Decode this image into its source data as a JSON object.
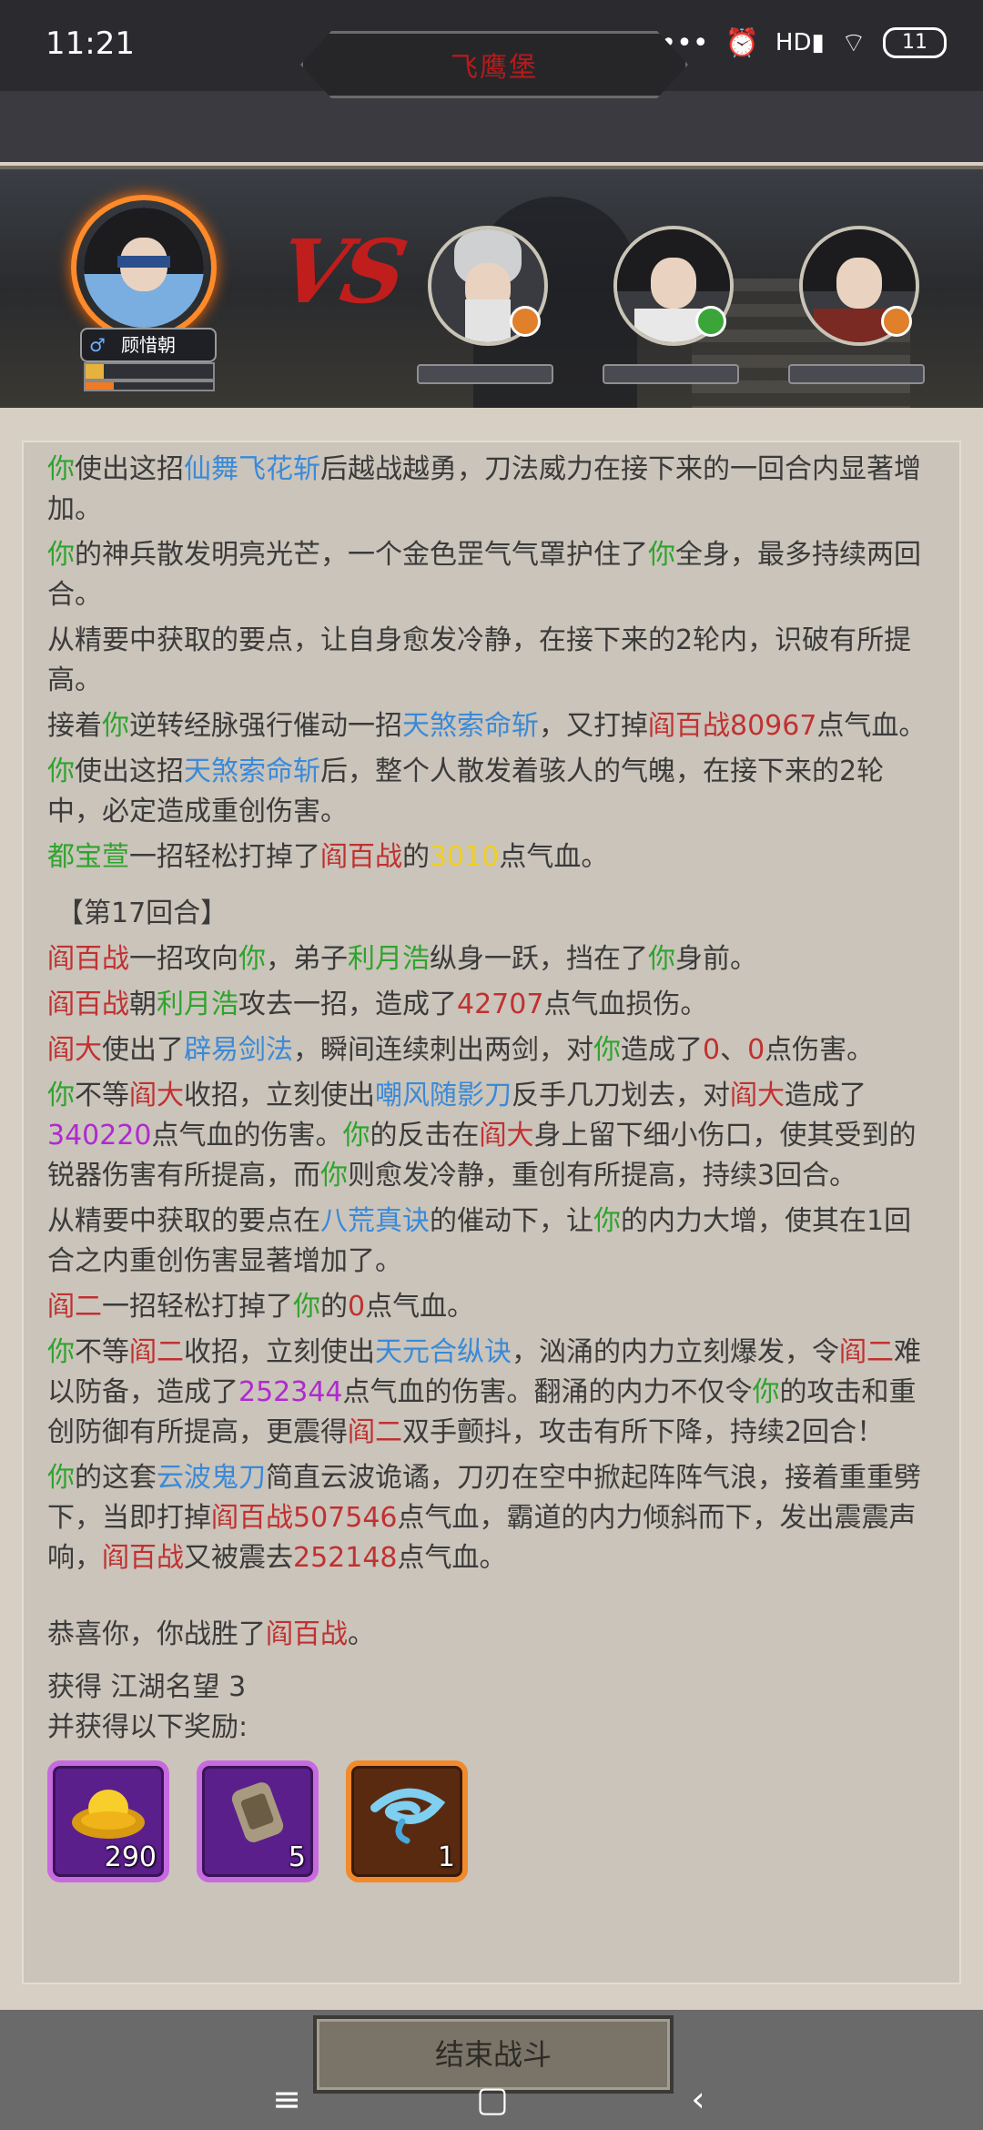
{
  "status_bar": {
    "time": "11:21",
    "icons": [
      "more-dots-icon",
      "alarm-icon",
      "hd-signal-icon",
      "wifi-icon"
    ],
    "battery": "11"
  },
  "header": {
    "title": "飞鹰堡"
  },
  "battle": {
    "player_name": "顾惜朝",
    "player_hp_fraction": 0.14,
    "player_energy_fraction": 0.22,
    "vs_label": "VS",
    "enemies": [
      {
        "portrait": "white-haired-elder",
        "badge_color": "#e0802a"
      },
      {
        "portrait": "white-robed-swordsman",
        "badge_color": "#3aa63a"
      },
      {
        "portrait": "red-robed-warrior",
        "badge_color": "#e0802a"
      }
    ]
  },
  "log": {
    "lines1": [
      [
        {
          "t": "你",
          "c": "g"
        },
        {
          "t": "使出这招"
        },
        {
          "t": "仙舞飞花斩",
          "c": "b"
        },
        {
          "t": "后越战越勇，刀法威力在接下来的一回合内显著增加。"
        }
      ],
      [
        {
          "t": "你",
          "c": "g"
        },
        {
          "t": "的神兵散发明亮光芒，一个金色罡气气罩护住了"
        },
        {
          "t": "你",
          "c": "g"
        },
        {
          "t": "全身，最多持续两回合。"
        }
      ],
      [
        {
          "t": "从精要中获取的要点，让自身愈发冷静，在接下来的2轮内，识破有所提高。"
        }
      ],
      [
        {
          "t": "接着"
        },
        {
          "t": "你",
          "c": "g"
        },
        {
          "t": "逆转经脉强行催动一招"
        },
        {
          "t": "天煞索命斩",
          "c": "b"
        },
        {
          "t": "，又打掉"
        },
        {
          "t": "阎百战",
          "c": "r"
        },
        {
          "t": "80967",
          "c": "r"
        },
        {
          "t": "点气血。"
        }
      ],
      [
        {
          "t": "你",
          "c": "g"
        },
        {
          "t": "使出这招"
        },
        {
          "t": "天煞索命斩",
          "c": "b"
        },
        {
          "t": "后，整个人散发着骇人的气魄，在接下来的2轮中，必定造成重创伤害。"
        }
      ],
      [
        {
          "t": "都宝萱",
          "c": "g"
        },
        {
          "t": "一招轻松打掉了"
        },
        {
          "t": "阎百战",
          "c": "r"
        },
        {
          "t": "的"
        },
        {
          "t": "3010",
          "c": "y"
        },
        {
          "t": "点气血。"
        }
      ]
    ],
    "round_header": "【第17回合】",
    "lines2": [
      [
        {
          "t": "阎百战",
          "c": "r"
        },
        {
          "t": "一招攻向"
        },
        {
          "t": "你",
          "c": "g"
        },
        {
          "t": "，弟子"
        },
        {
          "t": "利月浩",
          "c": "g"
        },
        {
          "t": "纵身一跃，挡在了"
        },
        {
          "t": "你",
          "c": "g"
        },
        {
          "t": "身前。"
        }
      ],
      [
        {
          "t": "阎百战",
          "c": "r"
        },
        {
          "t": "朝"
        },
        {
          "t": "利月浩",
          "c": "g"
        },
        {
          "t": "攻去一招，造成了"
        },
        {
          "t": "42707",
          "c": "r"
        },
        {
          "t": "点气血损伤。"
        }
      ],
      [
        {
          "t": "阎大",
          "c": "r"
        },
        {
          "t": "使出了"
        },
        {
          "t": "辟易剑法",
          "c": "b"
        },
        {
          "t": "，瞬间连续刺出两剑，对"
        },
        {
          "t": "你",
          "c": "g"
        },
        {
          "t": "造成了"
        },
        {
          "t": "0",
          "c": "r"
        },
        {
          "t": "、"
        },
        {
          "t": "0",
          "c": "r"
        },
        {
          "t": "点伤害。"
        }
      ],
      [
        {
          "t": "你",
          "c": "g"
        },
        {
          "t": "不等"
        },
        {
          "t": "阎大",
          "c": "r"
        },
        {
          "t": "收招，立刻使出"
        },
        {
          "t": "嘲风随影刀",
          "c": "b"
        },
        {
          "t": "反手几刀划去，对"
        },
        {
          "t": "阎大",
          "c": "r"
        },
        {
          "t": "造成了"
        },
        {
          "t": "340220",
          "c": "p"
        },
        {
          "t": "点气血的伤害。"
        },
        {
          "t": "你",
          "c": "g"
        },
        {
          "t": "的反击在"
        },
        {
          "t": "阎大",
          "c": "r"
        },
        {
          "t": "身上留下细小伤口，使其受到的锐器伤害有所提高，而"
        },
        {
          "t": "你",
          "c": "g"
        },
        {
          "t": "则愈发冷静，重创有所提高，持续3回合。"
        }
      ],
      [
        {
          "t": "从精要中获取的要点在"
        },
        {
          "t": "八荒真诀",
          "c": "b"
        },
        {
          "t": "的催动下，让"
        },
        {
          "t": "你",
          "c": "g"
        },
        {
          "t": "的内力大增，使其在1回合之内重创伤害显著增加了。"
        }
      ],
      [
        {
          "t": "阎二",
          "c": "r"
        },
        {
          "t": "一招轻松打掉了"
        },
        {
          "t": "你",
          "c": "g"
        },
        {
          "t": "的"
        },
        {
          "t": "0",
          "c": "r"
        },
        {
          "t": "点气血。"
        }
      ],
      [
        {
          "t": "你",
          "c": "g"
        },
        {
          "t": "不等"
        },
        {
          "t": "阎二",
          "c": "r"
        },
        {
          "t": "收招，立刻使出"
        },
        {
          "t": "天元合纵诀",
          "c": "b"
        },
        {
          "t": "，汹涌的内力立刻爆发，令"
        },
        {
          "t": "阎二",
          "c": "r"
        },
        {
          "t": "难以防备，造成了"
        },
        {
          "t": "252344",
          "c": "p"
        },
        {
          "t": "点气血的伤害。翻涌的内力不仅令"
        },
        {
          "t": "你",
          "c": "g"
        },
        {
          "t": "的攻击和重创防御有所提高，更震得"
        },
        {
          "t": "阎二",
          "c": "r"
        },
        {
          "t": "双手颤抖，攻击有所下降，持续2回合！"
        }
      ],
      [
        {
          "t": "你",
          "c": "g"
        },
        {
          "t": "的这套"
        },
        {
          "t": "云波鬼刀",
          "c": "b"
        },
        {
          "t": "简直云波诡谲，刀刃在空中掀起阵阵气浪，接着重重劈下，当即打掉"
        },
        {
          "t": "阎百战",
          "c": "r"
        },
        {
          "t": "507546",
          "c": "r"
        },
        {
          "t": "点气血，霸道的内力倾斜而下，发出震震声响，"
        },
        {
          "t": "阎百战",
          "c": "r"
        },
        {
          "t": "又被震去"
        },
        {
          "t": "252148",
          "c": "r"
        },
        {
          "t": "点气血。"
        }
      ]
    ],
    "victory": [
      {
        "t": "恭喜你，你战胜了"
      },
      {
        "t": "阎百战",
        "c": "r"
      },
      {
        "t": "。"
      }
    ]
  },
  "rewards": {
    "gain_line": "获得 江湖名望 3",
    "subtitle": "并获得以下奖励:",
    "items": [
      {
        "icon": "gold-ingot-icon",
        "count": "290",
        "rarity": "purple"
      },
      {
        "icon": "bronze-token-icon",
        "count": "5",
        "rarity": "purple"
      },
      {
        "icon": "blue-swirl-icon",
        "count": "1",
        "rarity": "orange"
      }
    ]
  },
  "end_button": "结束战斗",
  "nav": {
    "menu": "≡",
    "home": "▢",
    "back": "‹"
  }
}
